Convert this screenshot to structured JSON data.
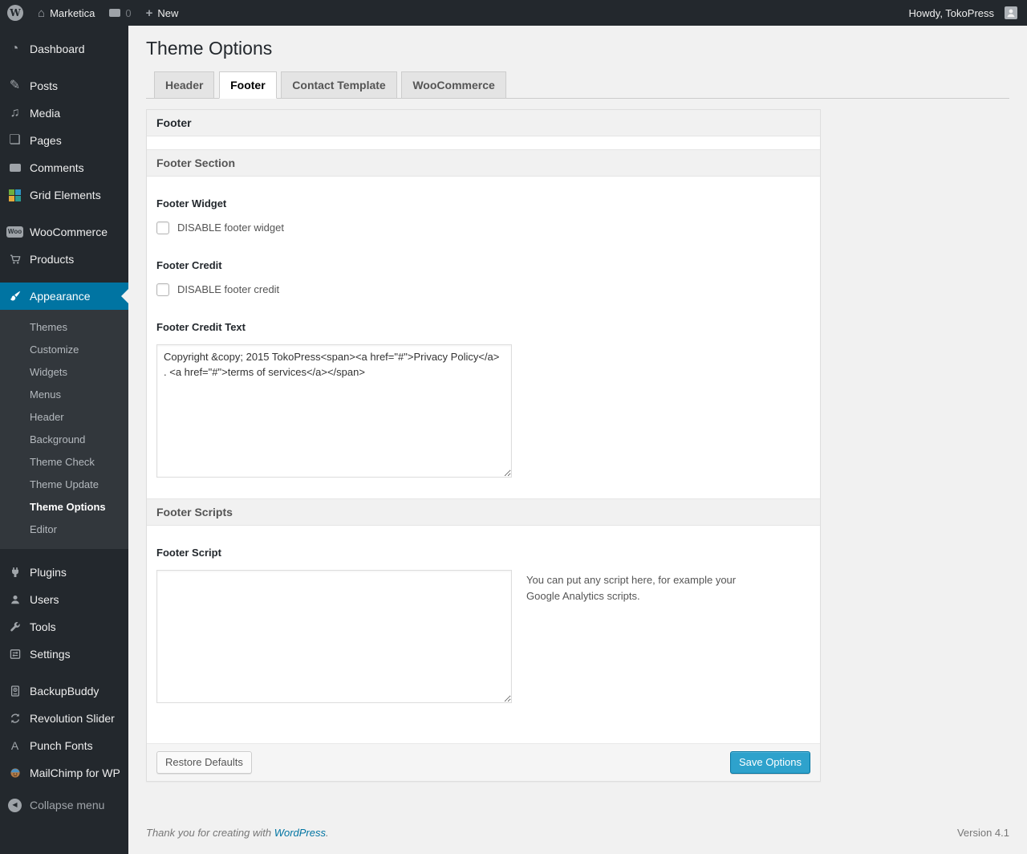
{
  "admin_bar": {
    "site_name": "Marketica",
    "comments_count": "0",
    "new_label": "New",
    "howdy": "Howdy, TokoPress"
  },
  "sidebar": {
    "menu": [
      {
        "id": "dashboard",
        "label": "Dashboard",
        "icon": "dashboard-icon",
        "sep_after": true
      },
      {
        "id": "posts",
        "label": "Posts",
        "icon": "posts-icon"
      },
      {
        "id": "media",
        "label": "Media",
        "icon": "media-icon"
      },
      {
        "id": "pages",
        "label": "Pages",
        "icon": "pages-icon"
      },
      {
        "id": "comments",
        "label": "Comments",
        "icon": "comments-icon"
      },
      {
        "id": "grid-elements",
        "label": "Grid Elements",
        "icon": "grid-elements-icon",
        "sep_after": true
      },
      {
        "id": "woocommerce",
        "label": "WooCommerce",
        "icon": "woocommerce-icon"
      },
      {
        "id": "products",
        "label": "Products",
        "icon": "products-icon",
        "sep_after": true
      },
      {
        "id": "appearance",
        "label": "Appearance",
        "icon": "appearance-icon",
        "active": true,
        "submenu": [
          {
            "label": "Themes"
          },
          {
            "label": "Customize"
          },
          {
            "label": "Widgets"
          },
          {
            "label": "Menus"
          },
          {
            "label": "Header"
          },
          {
            "label": "Background"
          },
          {
            "label": "Theme Check"
          },
          {
            "label": "Theme Update"
          },
          {
            "label": "Theme Options",
            "current": true
          },
          {
            "label": "Editor"
          }
        ],
        "sep_after": true
      },
      {
        "id": "plugins",
        "label": "Plugins",
        "icon": "plugins-icon"
      },
      {
        "id": "users",
        "label": "Users",
        "icon": "users-icon"
      },
      {
        "id": "tools",
        "label": "Tools",
        "icon": "tools-icon"
      },
      {
        "id": "settings",
        "label": "Settings",
        "icon": "settings-icon",
        "sep_after": true
      },
      {
        "id": "backupbuddy",
        "label": "BackupBuddy",
        "icon": "backupbuddy-icon"
      },
      {
        "id": "revolution-slider",
        "label": "Revolution Slider",
        "icon": "revolution-slider-icon"
      },
      {
        "id": "punch-fonts",
        "label": "Punch Fonts",
        "icon": "punch-fonts-icon"
      },
      {
        "id": "mailchimp",
        "label": "MailChimp for WP",
        "icon": "mailchimp-icon"
      }
    ],
    "collapse_label": "Collapse menu"
  },
  "page": {
    "title": "Theme Options",
    "tabs": [
      {
        "label": "Header",
        "active": false
      },
      {
        "label": "Footer",
        "active": true
      },
      {
        "label": "Contact Template",
        "active": false
      },
      {
        "label": "WooCommerce",
        "active": false
      }
    ]
  },
  "panel": {
    "group_title": "Footer",
    "sections": [
      {
        "title": "Footer Section",
        "fields": [
          {
            "type": "checkbox",
            "label": "Footer Widget",
            "checkbox_label": "DISABLE footer widget",
            "checked": false
          },
          {
            "type": "checkbox",
            "label": "Footer Credit",
            "checkbox_label": "DISABLE footer credit",
            "checked": false
          },
          {
            "type": "textarea",
            "label": "Footer Credit Text",
            "value": "Copyright &copy; 2015 TokoPress<span><a href=\"#\">Privacy Policy</a> . <a href=\"#\">terms of services</a></span>"
          }
        ]
      },
      {
        "title": "Footer Scripts",
        "fields": [
          {
            "type": "textarea",
            "label": "Footer Script",
            "value": "",
            "description": "You can put any script here, for example your Google Analytics scripts."
          }
        ]
      }
    ],
    "restore_button": "Restore Defaults",
    "save_button": "Save Options"
  },
  "footer": {
    "thanks_prefix": "Thank you for creating with ",
    "wordpress_link": "WordPress",
    "thanks_suffix": ".",
    "version": "Version 4.1"
  },
  "colors": {
    "admin_bar_bg": "#23282d",
    "sidebar_bg": "#23282d",
    "submenu_bg": "#32373c",
    "active_menu_bg": "#0074a2",
    "page_bg": "#f1f1f1",
    "primary_button_bg": "#2ea2cc",
    "primary_button_border": "#0074a2"
  }
}
